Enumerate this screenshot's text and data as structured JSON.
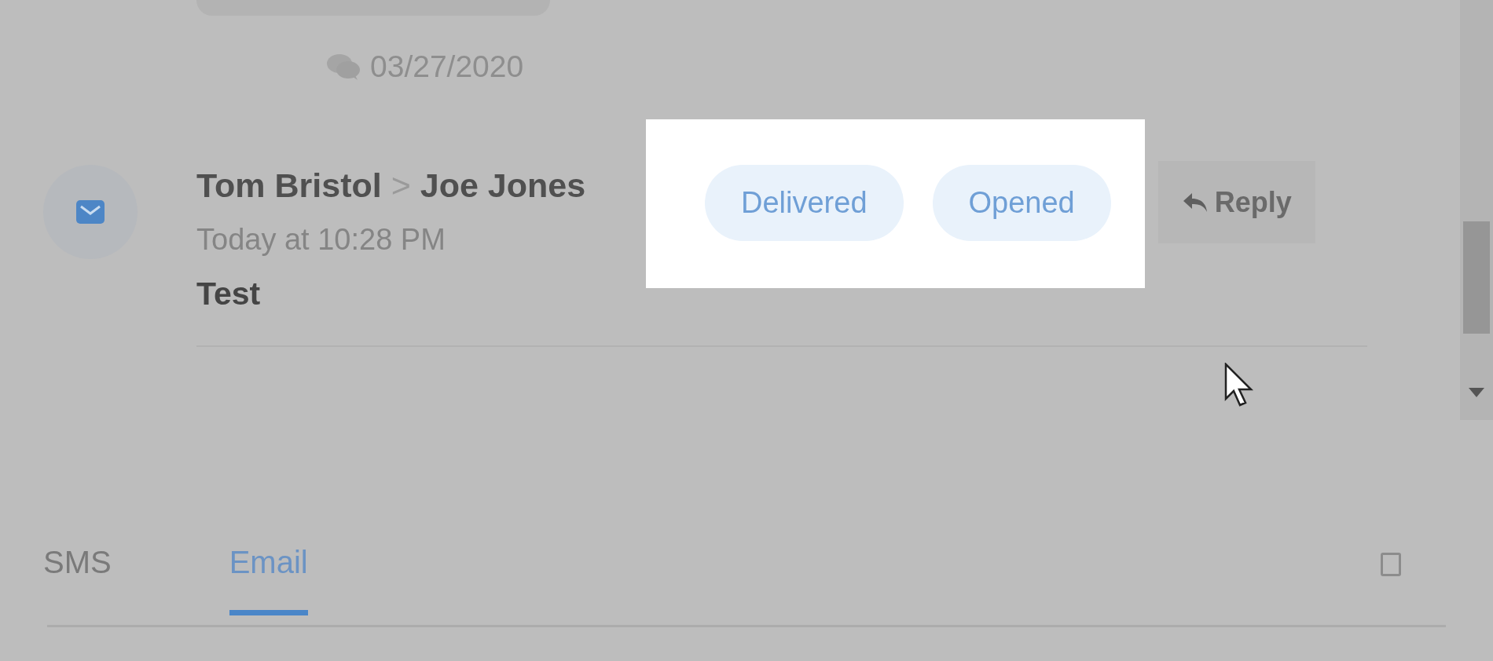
{
  "conversation": {
    "date": "03/27/2020",
    "message": {
      "sender": "Tom Bristol",
      "separator": ">",
      "recipient": "Joe Jones",
      "time": "Today at 10:28 PM",
      "subject": "Test",
      "statuses": [
        "Delivered",
        "Opened"
      ],
      "reply_label": "Reply"
    }
  },
  "tabs": [
    {
      "label": "SMS",
      "selected": false
    },
    {
      "label": "Email",
      "selected": true
    }
  ]
}
